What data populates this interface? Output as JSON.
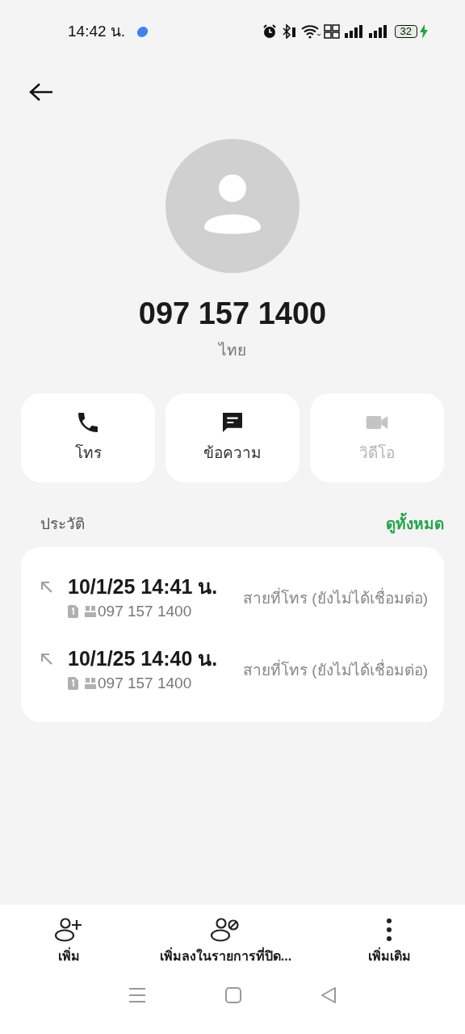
{
  "status_bar": {
    "time": "14:42 น.",
    "battery": "32"
  },
  "contact": {
    "number": "097 157 1400",
    "region": "ไทย"
  },
  "actions": [
    {
      "kind": "call",
      "label": "โทร",
      "disabled": false
    },
    {
      "kind": "message",
      "label": "ข้อความ",
      "disabled": false
    },
    {
      "kind": "video",
      "label": "วิดีโอ",
      "disabled": true
    }
  ],
  "history": {
    "title": "ประวัติ",
    "view_all": "ดูทั้งหมด",
    "entries": [
      {
        "time": "10/1/25 14:41 น.",
        "number": "097 157 1400",
        "status": "สายที่โทร (ยังไม่ได้เชื่อมต่อ)"
      },
      {
        "time": "10/1/25 14:40 น.",
        "number": "097 157 1400",
        "status": "สายที่โทร (ยังไม่ได้เชื่อมต่อ)"
      }
    ]
  },
  "bottom_actions": [
    {
      "kind": "add",
      "label": "เพิ่ม"
    },
    {
      "kind": "block",
      "label": "เพิ่มลงในรายการที่ปิด..."
    },
    {
      "kind": "more",
      "label": "เพิ่มเติม"
    }
  ]
}
